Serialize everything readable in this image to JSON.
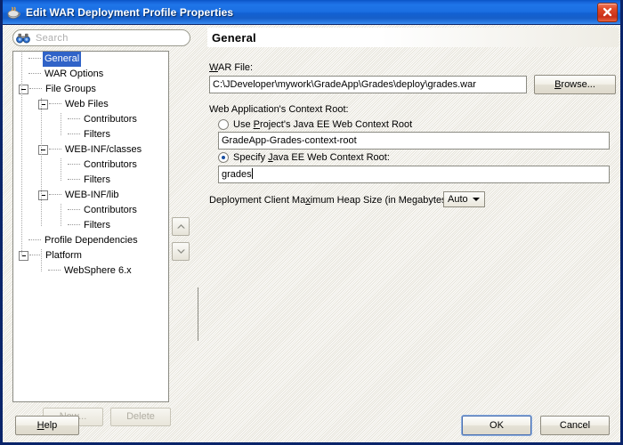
{
  "window": {
    "title": "Edit WAR Deployment Profile Properties",
    "icon": "java-coffee-cup-icon",
    "close_icon": "close-icon",
    "accent_titlebar": "#1f75e8",
    "accent_close": "#c9301a",
    "accent_selection": "#3063c8"
  },
  "search": {
    "placeholder": "Search",
    "icon": "binoculars-icon",
    "value": ""
  },
  "tree": {
    "selected": "General",
    "items": [
      {
        "label": "General",
        "depth": 0,
        "handle": "none",
        "selected": true
      },
      {
        "label": "WAR Options",
        "depth": 0,
        "handle": "none",
        "selected": false
      },
      {
        "label": "File Groups",
        "depth": 0,
        "handle": "minus",
        "selected": false
      },
      {
        "label": "Web Files",
        "depth": 1,
        "handle": "minus",
        "selected": false
      },
      {
        "label": "Contributors",
        "depth": 2,
        "handle": "none",
        "selected": false
      },
      {
        "label": "Filters",
        "depth": 2,
        "handle": "none",
        "selected": false
      },
      {
        "label": "WEB-INF/classes",
        "depth": 1,
        "handle": "minus",
        "selected": false
      },
      {
        "label": "Contributors",
        "depth": 2,
        "handle": "none",
        "selected": false
      },
      {
        "label": "Filters",
        "depth": 2,
        "handle": "none",
        "selected": false
      },
      {
        "label": "WEB-INF/lib",
        "depth": 1,
        "handle": "minus",
        "selected": false
      },
      {
        "label": "Contributors",
        "depth": 2,
        "handle": "none",
        "selected": false
      },
      {
        "label": "Filters",
        "depth": 2,
        "handle": "none",
        "selected": false
      },
      {
        "label": "Profile Dependencies",
        "depth": 0,
        "handle": "none",
        "selected": false
      },
      {
        "label": "Platform",
        "depth": 0,
        "handle": "minus",
        "selected": false
      },
      {
        "label": "WebSphere 6.x",
        "depth": 1,
        "handle": "none",
        "selected": false
      }
    ],
    "nudge_up_icon": "chevron-up-icon",
    "nudge_down_icon": "chevron-down-icon"
  },
  "tree_actions": {
    "new_label": "New...",
    "new_enabled": false,
    "delete_label": "Delete",
    "delete_enabled": false
  },
  "panel": {
    "title": "General",
    "war_file": {
      "label": "WAR File:",
      "value": "C:\\JDeveloper\\mywork\\GradeApp\\Grades\\deploy\\grades.war",
      "browse_label": "Browse..."
    },
    "context_root": {
      "label": "Web Application's Context Root:",
      "option_project": {
        "label": "Use Project's Java EE Web Context Root",
        "selected": false,
        "value": "GradeApp-Grades-context-root",
        "enabled": false
      },
      "option_specify": {
        "label": "Specify Java EE Web Context Root:",
        "selected": true,
        "value": "grades",
        "enabled": true
      }
    },
    "heap": {
      "label": "Deployment Client Maximum Heap Size (in Megabytes):",
      "value": "Auto"
    }
  },
  "footer": {
    "help_label": "Help",
    "ok_label": "OK",
    "cancel_label": "Cancel"
  }
}
